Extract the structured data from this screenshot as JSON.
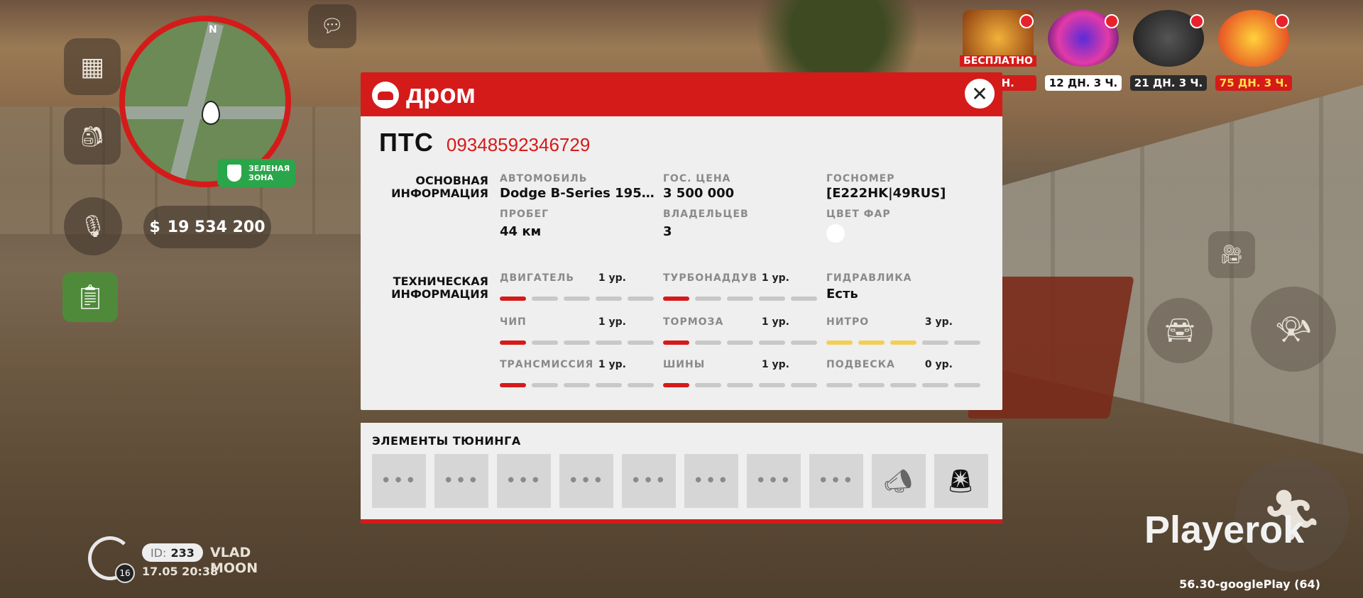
{
  "hud": {
    "money_symbol": "$",
    "money": "19 534 200",
    "zone": "ЗЕЛЕНАЯ ЗОНА",
    "minimap_north": "N"
  },
  "promos": [
    {
      "label": "МИН.",
      "tag": "БЕСПЛАТНО",
      "label_bg": "#d51a1a",
      "label_color": "#ffffff"
    },
    {
      "label": "12 ДН. 3 Ч.",
      "label_bg": "#ffffff",
      "label_color": "#111111"
    },
    {
      "label": "21 ДН. 3 Ч.",
      "label_bg": "#2b2b2b",
      "label_color": "#ffffff"
    },
    {
      "label": "75 ДН. 3 Ч.",
      "label_bg": "#d51a1a",
      "label_color": "#ffe14a"
    }
  ],
  "drom": {
    "brand": "дром",
    "pts_label": "ПТС",
    "pts_number": "09348592346729",
    "basic": {
      "title": "ОСНОВНАЯ ИНФОРМАЦИЯ",
      "fields": [
        {
          "caption": "АВТОМОБИЛЬ",
          "value": "Dodge B-Series 195…"
        },
        {
          "caption": "ГОС. ЦЕНА",
          "value": "3 500 000"
        },
        {
          "caption": "ГОСНОМЕР",
          "value": "[E222HK|49RUS]"
        },
        {
          "caption": "ПРОБЕГ",
          "value": "44 км"
        },
        {
          "caption": "ВЛАДЕЛЬЦЕВ",
          "value": "3"
        },
        {
          "caption": "ЦВЕТ ФАР",
          "value": ""
        }
      ],
      "headlight_color": "#ffffff"
    },
    "tech": {
      "title": "ТЕХНИЧЕСКАЯ ИНФОРМАЦИЯ",
      "items": [
        {
          "caption": "ДВИГАТЕЛЬ",
          "level": "1 ур.",
          "filled": 1
        },
        {
          "caption": "ТУРБОНАДДУВ",
          "level": "1 ур.",
          "filled": 1
        },
        {
          "caption": "ГИДРАВЛИКА",
          "value": "Есть"
        },
        {
          "caption": "ЧИП",
          "level": "1 ур.",
          "filled": 1
        },
        {
          "caption": "ТОРМОЗА",
          "level": "1 ур.",
          "filled": 1
        },
        {
          "caption": "НИТРО",
          "level": "3 ур.",
          "filled": 3
        },
        {
          "caption": "ТРАНСМИССИЯ",
          "level": "1 ур.",
          "filled": 1
        },
        {
          "caption": "ШИНЫ",
          "level": "1 ур.",
          "filled": 1
        },
        {
          "caption": "ПОДВЕСКА",
          "level": "0 ур.",
          "filled": 0
        }
      ]
    },
    "tuning": {
      "title": "ЭЛЕМЕНТЫ ТЮНИНГА",
      "slots": [
        "•••",
        "•••",
        "•••",
        "•••",
        "•••",
        "•••",
        "•••",
        "•••",
        "horn-icon",
        "siren-icon"
      ]
    }
  },
  "profile": {
    "level": "16",
    "id_label": "ID:",
    "id": "233",
    "name": "VLAD MOON",
    "datetime": "17.05 20:38"
  },
  "watermark": "Playerok",
  "version": "56.30-googlePlay (64)",
  "colors": {
    "accent": "#d51a1a",
    "nitro": "#f4cd5a",
    "bar_off": "#c8c8c8"
  }
}
